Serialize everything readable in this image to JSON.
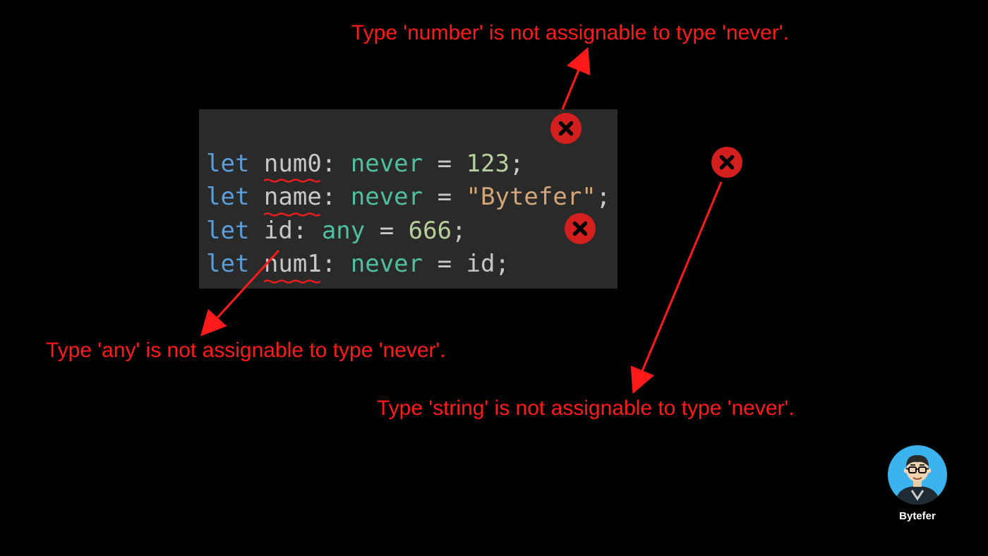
{
  "errors": {
    "number": "Type 'number' is not assignable to type 'never'.",
    "any": "Type 'any' is not assignable to type 'never'.",
    "string": "Type 'string' is not assignable to type 'never'."
  },
  "code": {
    "line1": {
      "kw": "let",
      "var": "num0",
      "colon": ":",
      "type": "never",
      "eq": " = ",
      "val": "123",
      "semi": ";"
    },
    "line2": {
      "kw": "let",
      "var": "name",
      "colon": ":",
      "type": "never",
      "eq": " = ",
      "val": "\"Bytefer\"",
      "semi": ";"
    },
    "line3": {
      "kw": "let",
      "var": "id",
      "colon": ":",
      "type": "any",
      "eq": " = ",
      "val": "666",
      "semi": ";"
    },
    "line4": {
      "kw": "let",
      "var": "num1",
      "colon": ":",
      "type": "never",
      "eq": " = ",
      "val": "id",
      "semi": ";"
    }
  },
  "author": {
    "name": "Bytefer"
  },
  "colors": {
    "error": "#ff1a1a",
    "error_bg": "#d3201f",
    "code_bg": "#2a2a2a",
    "keyword": "#5a9ed9",
    "type": "#4fbfa0",
    "number": "#b6cf9b",
    "string": "#d2a679",
    "text": "#c7c8c9"
  }
}
